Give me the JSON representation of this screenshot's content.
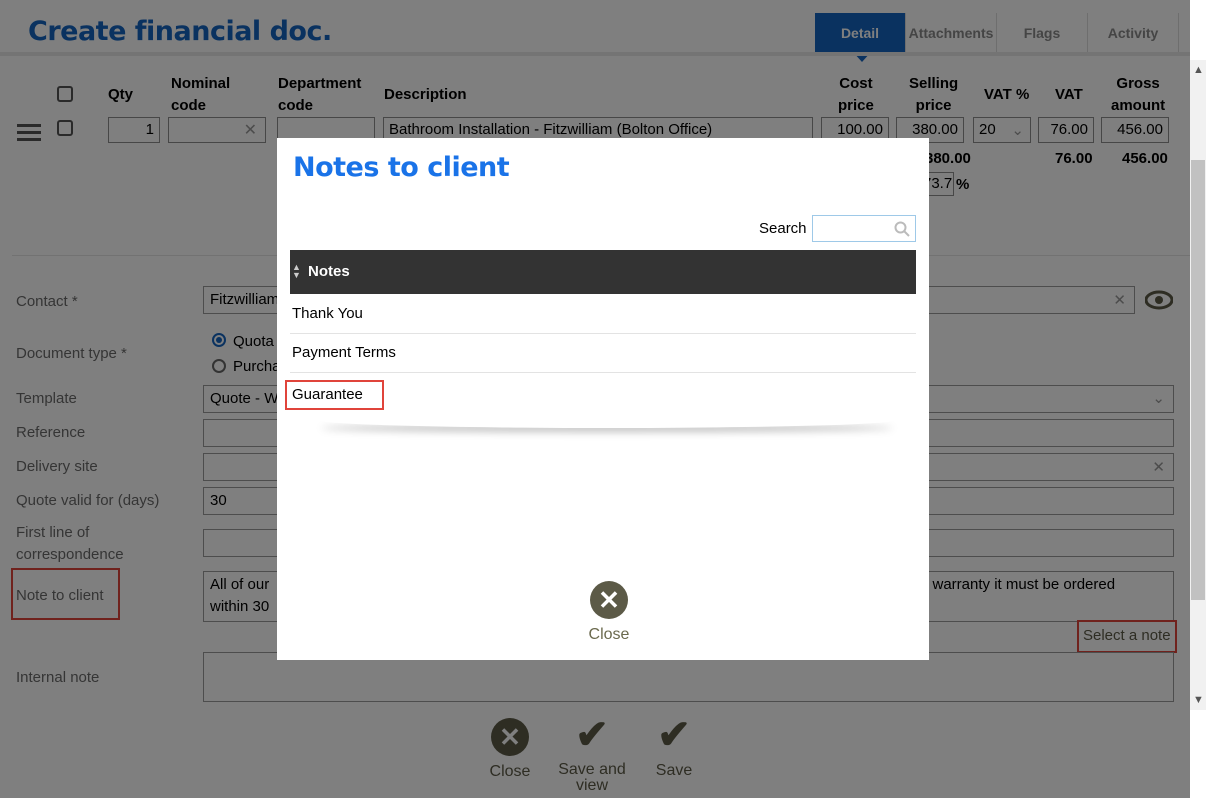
{
  "page": {
    "title": "Create financial doc."
  },
  "tabs": [
    {
      "label": "Detail"
    },
    {
      "label": "Attachments"
    },
    {
      "label": "Flags"
    },
    {
      "label": "Activity"
    }
  ],
  "line_table": {
    "headers": {
      "qty": "Qty",
      "nominal_code_1": "Nominal",
      "nominal_code_2": "code",
      "department_code_1": "Department",
      "department_code_2": "code",
      "description": "Description",
      "cost_price_1": "Cost",
      "cost_price_2": "price",
      "selling_price_1": "Selling",
      "selling_price_2": "price",
      "vat_percent": "VAT %",
      "vat": "VAT",
      "gross_1": "Gross",
      "gross_2": "amount"
    },
    "row": {
      "qty": "1",
      "description": "Bathroom Installation - Fitzwilliam (Bolton Office)",
      "cost_price": "100.00",
      "selling_price": "380.00",
      "vat_percent": "20",
      "vat": "76.00",
      "gross": "456.00"
    },
    "totals": {
      "selling_price": "380.00",
      "vat": "76.00",
      "gross": "456.00",
      "margin_value": "73.7",
      "margin_unit": "%"
    }
  },
  "form": {
    "contact_label": "Contact *",
    "contact_value": "Fitzwilliam",
    "document_type_label": "Document type *",
    "document_type_options": [
      "Quota",
      "Purcha"
    ],
    "template_label": "Template",
    "template_value": "Quote - W",
    "reference_label": "Reference",
    "delivery_site_label": "Delivery site",
    "quote_valid_label": "Quote valid for (days)",
    "quote_valid_value": "30",
    "first_line_label_1": "First line of",
    "first_line_label_2": "correspondence",
    "note_to_client_label": "Note to client",
    "note_to_client_value_1": "All of our",
    "note_to_client_value_1b": "ar warranty it must be ordered",
    "note_to_client_value_2": "within 30",
    "select_note_link": "Select a note",
    "internal_note_label": "Internal note"
  },
  "bottom_buttons": {
    "close": "Close",
    "save_and_view_1": "Save and",
    "save_and_view_2": "view",
    "save": "Save"
  },
  "modal": {
    "title": "Notes to client",
    "search_label": "Search",
    "column_header": "Notes",
    "notes": [
      "Thank You",
      "Payment Terms",
      "Guarantee"
    ],
    "close_label": "Close"
  },
  "colors": {
    "brand_blue": "#1565c0",
    "highlight_red": "#e0443b",
    "button_olive": "#5c5a47"
  }
}
